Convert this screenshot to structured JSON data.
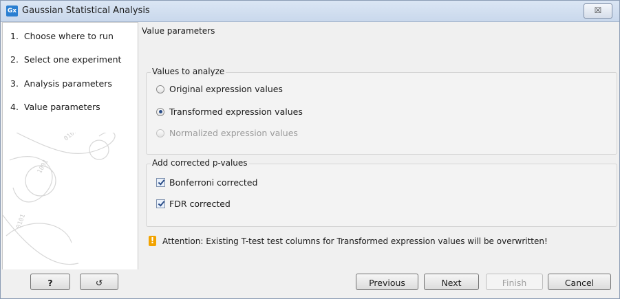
{
  "window": {
    "title": "Gaussian Statistical Analysis",
    "app_icon_text": "Gx",
    "close_glyph": "☒"
  },
  "sidebar": {
    "steps": [
      {
        "number": "1.",
        "label": "Choose where to run"
      },
      {
        "number": "2.",
        "label": "Select one experiment"
      },
      {
        "number": "3.",
        "label": "Analysis parameters"
      },
      {
        "number": "4.",
        "label": "Value parameters"
      }
    ]
  },
  "main": {
    "section_title": "Value parameters",
    "values_group": {
      "title": "Values to analyze",
      "options": [
        {
          "label": "Original expression values",
          "selected": false,
          "enabled": true
        },
        {
          "label": "Transformed expression values",
          "selected": true,
          "enabled": true
        },
        {
          "label": "Normalized expression values",
          "selected": false,
          "enabled": false
        }
      ]
    },
    "pvalues_group": {
      "title": "Add corrected p-values",
      "options": [
        {
          "label": "Bonferroni corrected",
          "checked": true
        },
        {
          "label": "FDR corrected",
          "checked": true
        }
      ]
    },
    "attention": {
      "icon": "!",
      "text": "Attention: Existing T-test test columns for Transformed expression values will be overwritten!"
    }
  },
  "footer": {
    "help_label": "?",
    "reset_icon": "↺",
    "previous_label": "Previous",
    "next_label": "Next",
    "finish_label": "Finish",
    "cancel_label": "Cancel"
  },
  "colors": {
    "accent": "#2b7fd1",
    "warning": "#f2a300",
    "selected_dot": "#2a4d88"
  }
}
